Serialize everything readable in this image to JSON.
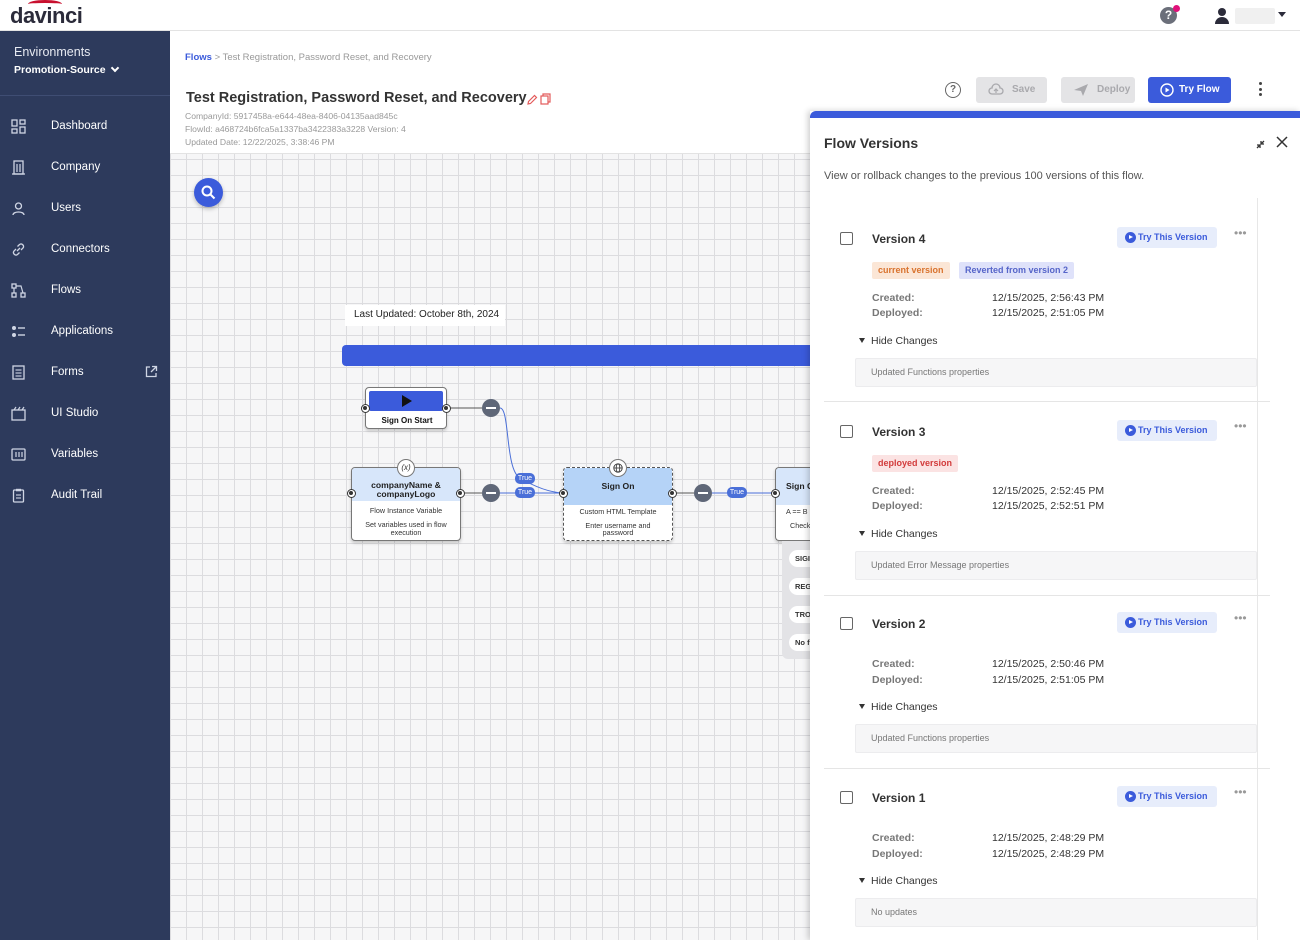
{
  "app": {
    "logo": "davinci"
  },
  "sidebar": {
    "env_label": "Environments",
    "env_value": "Promotion-Source",
    "items": [
      {
        "label": "Dashboard",
        "icon": "dashboard-icon"
      },
      {
        "label": "Company",
        "icon": "building-icon"
      },
      {
        "label": "Users",
        "icon": "user-icon"
      },
      {
        "label": "Connectors",
        "icon": "link-icon"
      },
      {
        "label": "Flows",
        "icon": "flow-icon"
      },
      {
        "label": "Applications",
        "icon": "applications-icon"
      },
      {
        "label": "Forms",
        "icon": "form-icon"
      },
      {
        "label": "UI Studio",
        "icon": "ui-studio-icon"
      },
      {
        "label": "Variables",
        "icon": "variables-icon"
      },
      {
        "label": "Audit Trail",
        "icon": "clipboard-icon"
      }
    ]
  },
  "header": {
    "breadcrumb_root": "Flows",
    "breadcrumb_sep": ">",
    "breadcrumb_current": "Test Registration, Password Reset, and Recovery",
    "title": "Test Registration, Password Reset, and Recovery",
    "company_id": "CompanyId: 5917458a-e644-48ea-8406-04135aad845c",
    "flow_id": "FlowId: a468724b6fca5a1337ba3422383a3228 Version: 4",
    "updated": "Updated Date: 12/22/2025, 3:38:46 PM",
    "save_label": "Save",
    "deploy_label": "Deploy",
    "try_label": "Try Flow"
  },
  "canvas": {
    "note": "Last Updated: October 8th, 2024",
    "start_node": {
      "label": "Sign On Start"
    },
    "var_node": {
      "title_line1": "companyName &",
      "title_line2": "companyLogo",
      "type": "Flow Instance Variable",
      "desc_line1": "Set variables used in flow",
      "desc_line2": "execution",
      "badge": "(x)"
    },
    "sign_node": {
      "title": "Sign On",
      "type": "Custom HTML Template",
      "desc_line1": "Enter username and",
      "desc_line2": "password"
    },
    "cut_node": {
      "title": "Sign O",
      "type": "A == B",
      "desc": "Check"
    },
    "true_labels": [
      "True",
      "True",
      "True"
    ],
    "branches": [
      "SIGI",
      "REG",
      "TRO",
      "No f"
    ]
  },
  "versions_panel": {
    "title": "Flow Versions",
    "description": "View or rollback changes to the previous 100 versions of this flow.",
    "try_version_label": "Try This Version",
    "created_label": "Created:",
    "deployed_label": "Deployed:",
    "hide_changes_label": "Hide Changes",
    "versions": [
      {
        "name": "Version 4",
        "badges": [
          "current version",
          "Reverted from version 2"
        ],
        "created": "12/15/2025, 2:56:43 PM",
        "deployed": "12/15/2025, 2:51:05 PM",
        "changes": "Updated Functions properties"
      },
      {
        "name": "Version 3",
        "badges": [
          "deployed version"
        ],
        "created": "12/15/2025, 2:52:45 PM",
        "deployed": "12/15/2025, 2:52:51 PM",
        "changes": "Updated Error Message properties"
      },
      {
        "name": "Version 2",
        "badges": [],
        "created": "12/15/2025, 2:50:46 PM",
        "deployed": "12/15/2025, 2:51:05 PM",
        "changes": "Updated Functions properties"
      },
      {
        "name": "Version 1",
        "badges": [],
        "created": "12/15/2025, 2:48:29 PM",
        "deployed": "12/15/2025, 2:48:29 PM",
        "changes": "No updates"
      }
    ]
  },
  "colors": {
    "primary": "#3b5bdb",
    "sidebar": "#2d3a5c",
    "current_badge": "#d9732e",
    "deployed_badge": "#d23b3b",
    "reverted_badge": "#5665c9"
  }
}
